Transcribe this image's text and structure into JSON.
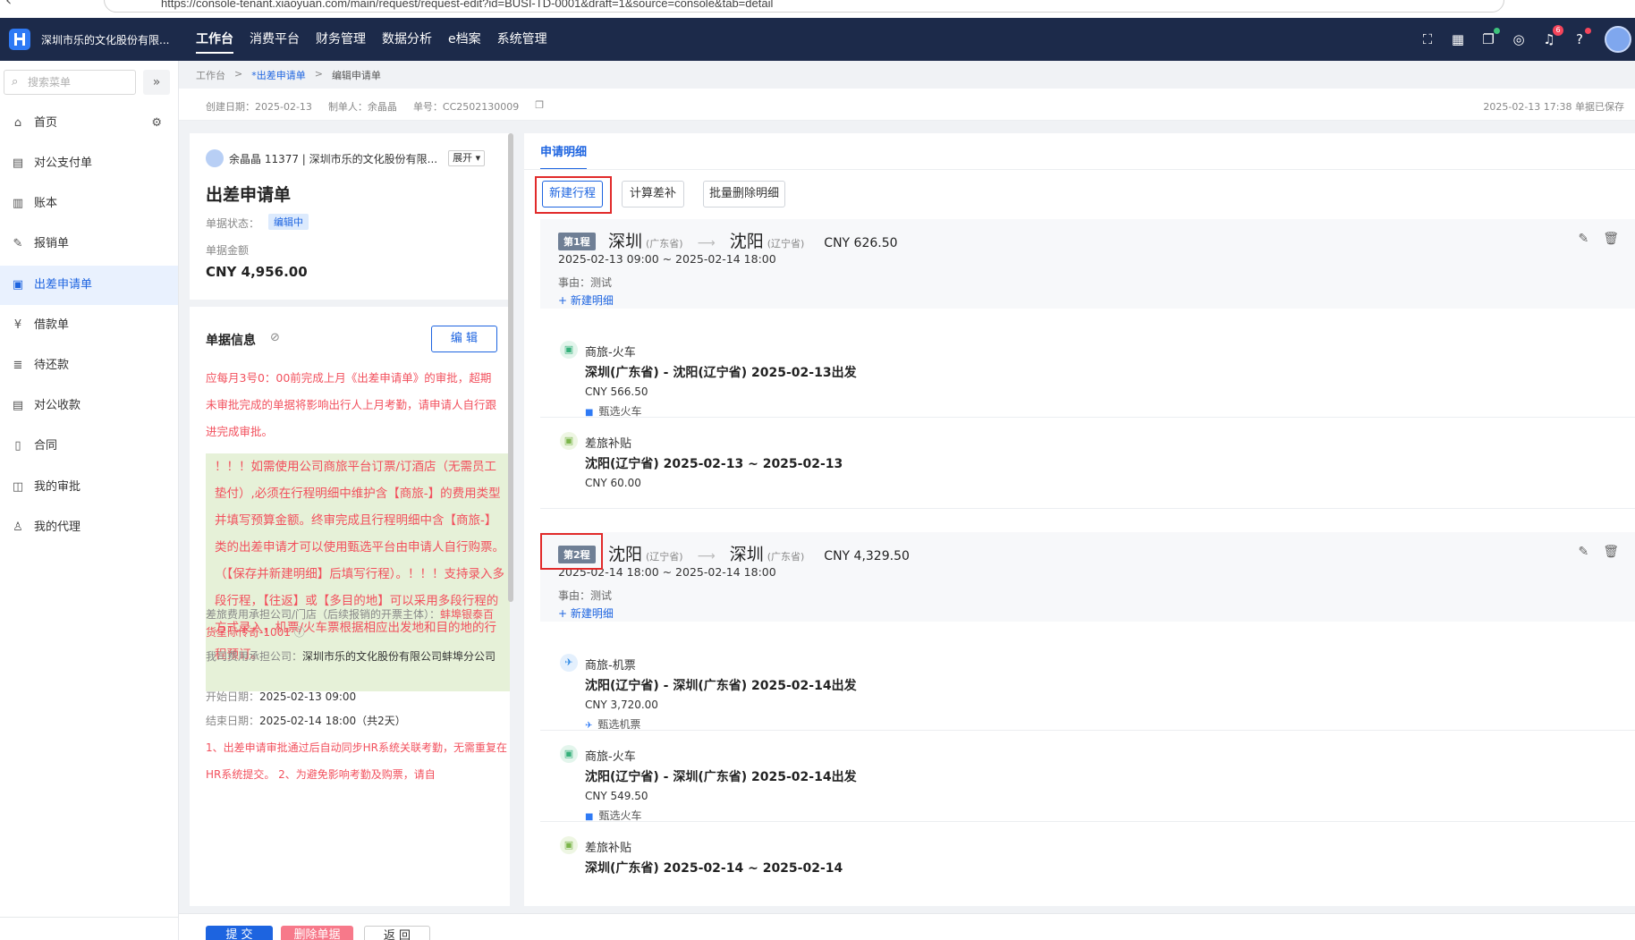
{
  "browser": {
    "url": "https://console-tenant.xiaoyuan.com/main/request/request-edit?id=BUSI-TD-0001&draft=1&source=console&tab=detail"
  },
  "topbar": {
    "company": "深圳市乐的文化股份有限...",
    "menu": [
      "工作台",
      "消费平台",
      "财务管理",
      "数据分析",
      "e档案",
      "系统管理"
    ],
    "notification_count": "6"
  },
  "sidebar": {
    "search_placeholder": "搜索菜单",
    "items": [
      {
        "label": "首页"
      },
      {
        "label": "对公支付单"
      },
      {
        "label": "账本"
      },
      {
        "label": "报销单"
      },
      {
        "label": "出差申请单"
      },
      {
        "label": "借款单"
      },
      {
        "label": "待还款"
      },
      {
        "label": "对公收款"
      },
      {
        "label": "合同"
      },
      {
        "label": "我的审批"
      },
      {
        "label": "我的代理"
      }
    ]
  },
  "breadcrumb": [
    "工作台",
    "*出差申请单",
    "编辑申请单"
  ],
  "info": {
    "created": "创建日期：2025-02-13",
    "maker": "制单人：余晶晶",
    "number": "单号：CC2502130009",
    "saved": "2025-02-13 17:38 单据已保存"
  },
  "summary": {
    "user": "余晶晶 11377 | 深圳市乐的文化股份有限...",
    "expand": "展开",
    "title": "出差申请单",
    "status_label": "单据状态：",
    "status": "编辑中",
    "amount_label": "单据金额",
    "amount": "CNY 4,956.00"
  },
  "doc_info": {
    "title": "单据信息",
    "edit": "编 辑",
    "notice1": "应每月3号0：00前完成上月《出差申请单》的审批，超期未审批完成的单据将影响出行人上月考勤，请申请人自行跟进完成审批。",
    "notice2": "！！！如需使用公司商旅平台订票/订酒店（无需员工垫付）,必须在行程明细中维护含【商旅-】的费用类型并填写预算金额。终审完成且行程明细中含【商旅-】类的出差申请才可以使用甄选平台由申请人自行购票。（【保存并新建明细】后填写行程）。！！！支持录入多段行程，【往返】或【多目的地】可以采用多段行程的方式录入，机票/火车票根据相应出发地和目的地的行程预订。",
    "bearer_label": "差旅费用承担公司/门店（后续报销的开票主体）：",
    "bearer_value": "蚌埠银泰百货星际传奇-1001",
    "our_company_label": "我司费用承担公司：",
    "our_company_value": "深圳市乐的文化股份有限公司蚌埠分公司",
    "start_label": "开始日期：",
    "start_value": "2025-02-13 09:00",
    "end_label": "结束日期：",
    "end_value": "2025-02-14 18:00（共2天）",
    "notice3": "1、出差申请审批通过后自动同步HR系统关联考勤，无需重复在HR系统提交。 2、为避免影响考勤及购票，请自"
  },
  "detail_panel": {
    "tab": "申请明细",
    "new_trip": "新建行程",
    "calc_diff": "计算差补",
    "batch_delete": "批量删除明细",
    "trips": [
      {
        "no": "第1程",
        "from_city": "深圳",
        "from_prov": "(广东省)",
        "to_city": "沈阳",
        "to_prov": "(辽宁省)",
        "amount": "CNY 626.50",
        "time": "2025-02-13 09:00 ~ 2025-02-14 18:00",
        "reason": "事由：测试",
        "add": "新建明细",
        "details": [
          {
            "type": "商旅-火车",
            "route": "深圳(广东省) - 沈阳(辽宁省)   2025-02-13出发",
            "amount": "CNY 566.50",
            "source": "甄选火车",
            "icon": "train"
          },
          {
            "type": "差旅补贴",
            "route": "沈阳(辽宁省)   2025-02-13 ~ 2025-02-13",
            "amount": "CNY 60.00",
            "icon": "allow"
          }
        ]
      },
      {
        "no": "第2程",
        "from_city": "沈阳",
        "from_prov": "(辽宁省)",
        "to_city": "深圳",
        "to_prov": "(广东省)",
        "amount": "CNY 4,329.50",
        "time": "2025-02-14 18:00 ~ 2025-02-14 18:00",
        "reason": "事由：测试",
        "add": "新建明细",
        "details": [
          {
            "type": "商旅-机票",
            "route": "沈阳(辽宁省) - 深圳(广东省)   2025-02-14出发",
            "amount": "CNY 3,720.00",
            "source": "甄选机票",
            "icon": "plane"
          },
          {
            "type": "商旅-火车",
            "route": "沈阳(辽宁省) - 深圳(广东省)   2025-02-14出发",
            "amount": "CNY 549.50",
            "source": "甄选火车",
            "icon": "train"
          },
          {
            "type": "差旅补贴",
            "route": "深圳(广东省)   2025-02-14 ~ 2025-02-14",
            "icon": "allow"
          }
        ]
      }
    ]
  },
  "bottom": {
    "submit": "提 交",
    "delete": "删除单据",
    "back": "返 回"
  }
}
